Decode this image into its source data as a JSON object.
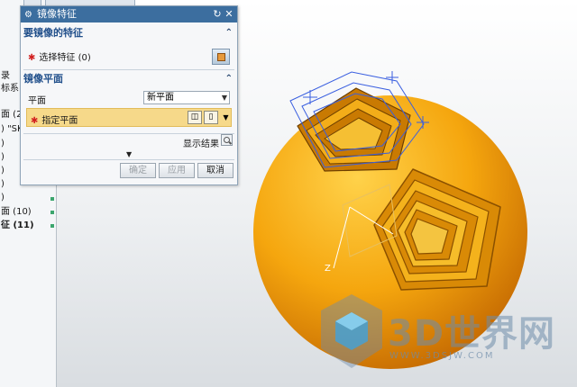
{
  "dialog": {
    "title": "镜像特征",
    "reset_icon": "reset-icon",
    "close_label": "✕"
  },
  "section_feature": {
    "heading": "要镜像的特征",
    "required_mark": "✱",
    "select_label": "选择特征 (0)"
  },
  "section_plane": {
    "heading": "镜像平面",
    "plane_label": "平面",
    "plane_value": "新平面",
    "required_mark": "✱",
    "specify_label": "指定平面"
  },
  "preview": {
    "show_result": "显示结果"
  },
  "buttons": {
    "ok": "确定",
    "apply": "应用",
    "cancel": "取消"
  },
  "tree": {
    "rows": [
      {
        "text": "录"
      },
      {
        "text": "标系"
      },
      {
        "text": "面 (2"
      },
      {
        "text": ") \"SK"
      },
      {
        "text": ")"
      },
      {
        "text": ")"
      },
      {
        "text": ")"
      },
      {
        "text": ")"
      },
      {
        "text": ")"
      },
      {
        "text": "面 (10)"
      },
      {
        "text": "征 (11)"
      }
    ]
  },
  "viewport": {
    "axis_label": "Z",
    "sphere_color": "#f2a30f"
  },
  "watermark": {
    "text": "3D世界网",
    "url": "WWW.3DSJW.COM"
  },
  "colors": {
    "title_bar": "#3c6e9f",
    "section_heading": "#1f4e8a",
    "highlight_row": "#f6d98a",
    "sketch_blue": "#3a5fe0"
  }
}
